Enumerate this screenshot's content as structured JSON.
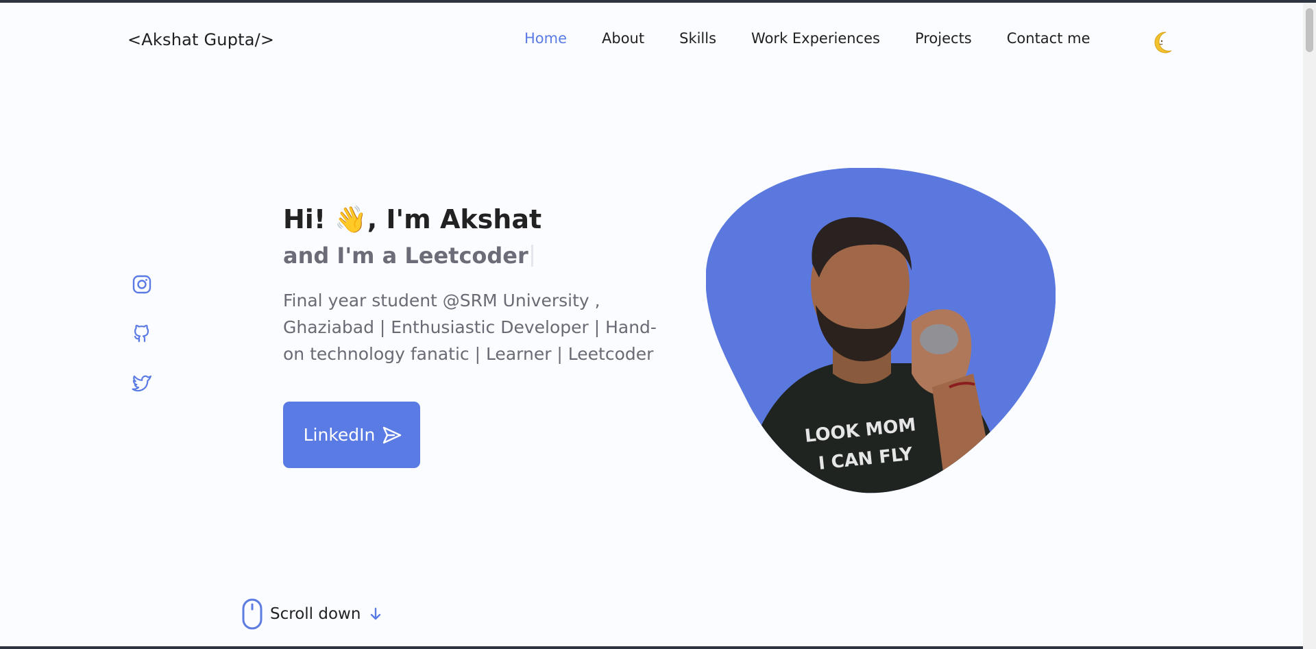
{
  "header": {
    "logo": "<Akshat Gupta/>",
    "nav": [
      "Home",
      "About",
      "Skills",
      "Work Experiences",
      "Projects",
      "Contact me"
    ],
    "active_nav": "Home",
    "theme_icon": "moon-icon"
  },
  "social": {
    "icons": [
      "instagram-icon",
      "github-icon",
      "twitter-icon"
    ]
  },
  "hero": {
    "greeting": "Hi! 👋, I'm Akshat",
    "subtitle": "and I'm a Leetcoder",
    "description": "Final year student @SRM University , Ghaziabad | Enthusiastic Developer | Hand-on technology fanatic | Learner | Leetcoder",
    "button_label": "LinkedIn",
    "button_icon": "send-icon"
  },
  "profile_image": {
    "description_icon": "profile-photo",
    "shirt_text": "LOOK MOM I CAN FLY"
  },
  "scroll": {
    "label": "Scroll down",
    "icons": [
      "mouse-icon",
      "arrow-down-icon"
    ]
  },
  "colors": {
    "accent": "#5b7be4",
    "background": "#fbfcff",
    "text": "#232323",
    "muted": "#6a6a74"
  }
}
